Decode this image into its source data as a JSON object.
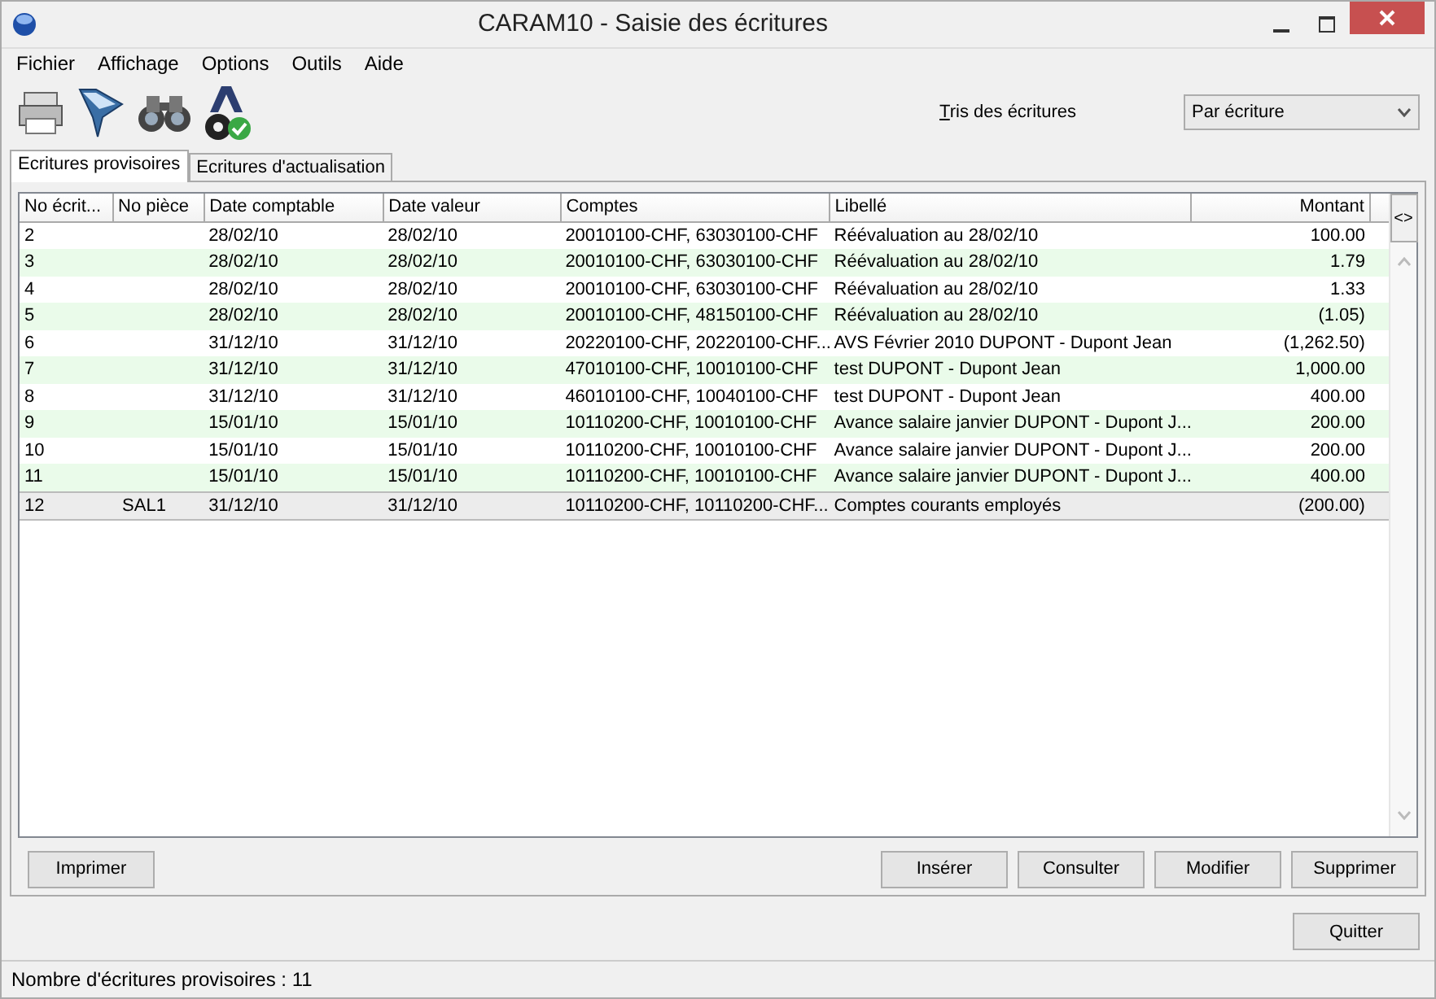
{
  "window": {
    "title": "CARAM10 - Saisie des écritures"
  },
  "menu": [
    "Fichier",
    "Affichage",
    "Options",
    "Outils",
    "Aide"
  ],
  "sort": {
    "label": "Tris des écritures",
    "value": "Par écriture"
  },
  "tabs": [
    {
      "label": "Ecritures provisoires",
      "selected": true
    },
    {
      "label": "Ecritures d'actualisation",
      "selected": false
    }
  ],
  "table": {
    "columns": [
      "No écrit...",
      "No pièce",
      "Date comptable",
      "Date valeur",
      "Comptes",
      "Libellé",
      "Montant"
    ],
    "column_button": "<>",
    "rows": [
      {
        "cells": [
          "2",
          "",
          "28/02/10",
          "28/02/10",
          "20010100-CHF, 63030100-CHF",
          "Réévaluation au 28/02/10",
          "100.00"
        ],
        "selected": false
      },
      {
        "cells": [
          "3",
          "",
          "28/02/10",
          "28/02/10",
          "20010100-CHF, 63030100-CHF",
          "Réévaluation au 28/02/10",
          "1.79"
        ],
        "selected": false
      },
      {
        "cells": [
          "4",
          "",
          "28/02/10",
          "28/02/10",
          "20010100-CHF, 63030100-CHF",
          "Réévaluation au 28/02/10",
          "1.33"
        ],
        "selected": false
      },
      {
        "cells": [
          "5",
          "",
          "28/02/10",
          "28/02/10",
          "20010100-CHF, 48150100-CHF",
          "Réévaluation au 28/02/10",
          "(1.05)"
        ],
        "selected": false
      },
      {
        "cells": [
          "6",
          "",
          "31/12/10",
          "31/12/10",
          "20220100-CHF, 20220100-CHF...",
          "AVS Février 2010 DUPONT - Dupont Jean",
          "(1,262.50)"
        ],
        "selected": false
      },
      {
        "cells": [
          "7",
          "",
          "31/12/10",
          "31/12/10",
          "47010100-CHF, 10010100-CHF",
          "test DUPONT - Dupont Jean",
          "1,000.00"
        ],
        "selected": false
      },
      {
        "cells": [
          "8",
          "",
          "31/12/10",
          "31/12/10",
          "46010100-CHF, 10040100-CHF",
          "test DUPONT - Dupont Jean",
          "400.00"
        ],
        "selected": false
      },
      {
        "cells": [
          "9",
          "",
          "15/01/10",
          "15/01/10",
          "10110200-CHF, 10010100-CHF",
          "Avance salaire janvier DUPONT - Dupont J...",
          "200.00"
        ],
        "selected": false
      },
      {
        "cells": [
          "10",
          "",
          "15/01/10",
          "15/01/10",
          "10110200-CHF, 10010100-CHF",
          "Avance salaire janvier DUPONT - Dupont J...",
          "200.00"
        ],
        "selected": false
      },
      {
        "cells": [
          "11",
          "",
          "15/01/10",
          "15/01/10",
          "10110200-CHF, 10010100-CHF",
          "Avance salaire janvier DUPONT - Dupont J...",
          "400.00"
        ],
        "selected": false
      },
      {
        "cells": [
          "12",
          "SAL1",
          "31/12/10",
          "31/12/10",
          "10110200-CHF, 10110200-CHF...",
          "Comptes courants employés",
          "(200.00)"
        ],
        "selected": true
      }
    ]
  },
  "panel_buttons": [
    "Imprimer",
    "Insérer",
    "Consulter",
    "Modifier",
    "Supprimer"
  ],
  "footer_button": "Quitter",
  "status_bar": "Nombre d'écritures provisoires : 11"
}
